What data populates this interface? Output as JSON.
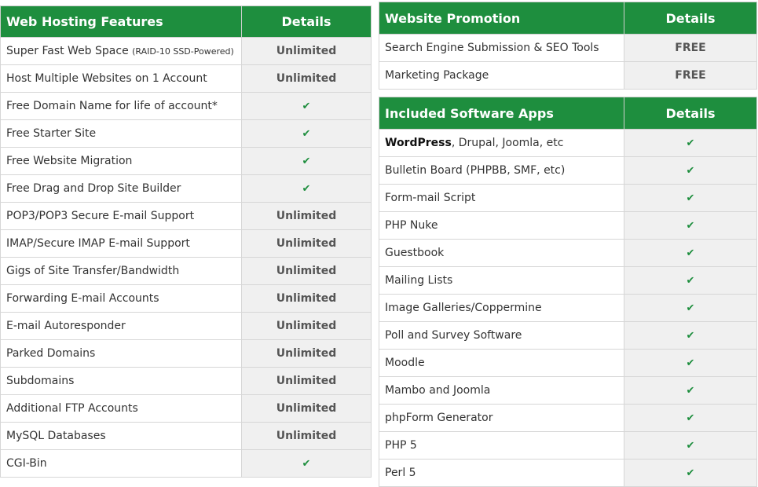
{
  "hosting": {
    "header": {
      "feature": "Web Hosting Features",
      "details": "Details"
    },
    "rows": [
      {
        "label": "Super Fast Web Space",
        "note": "(RAID-10 SSD-Powered)",
        "value": "Unlimited"
      },
      {
        "label": "Host Multiple Websites on 1 Account",
        "value": "Unlimited"
      },
      {
        "label": "Free Domain Name for life of account*",
        "value": "✔"
      },
      {
        "label": "Free Starter Site",
        "value": "✔"
      },
      {
        "label": "Free Website Migration",
        "value": "✔"
      },
      {
        "label": "Free Drag and Drop Site Builder",
        "value": "✔"
      },
      {
        "label": "POP3/POP3 Secure E-mail Support",
        "value": "Unlimited"
      },
      {
        "label": "IMAP/Secure IMAP E-mail Support",
        "value": "Unlimited"
      },
      {
        "label": "Gigs of Site Transfer/Bandwidth",
        "value": "Unlimited"
      },
      {
        "label": "Forwarding E-mail Accounts",
        "value": "Unlimited"
      },
      {
        "label": "E-mail Autoresponder",
        "value": "Unlimited"
      },
      {
        "label": "Parked Domains",
        "value": "Unlimited"
      },
      {
        "label": "Subdomains",
        "value": "Unlimited"
      },
      {
        "label": "Additional FTP Accounts",
        "value": "Unlimited"
      },
      {
        "label": "MySQL Databases",
        "value": "Unlimited"
      },
      {
        "label": "CGI-Bin",
        "value": "✔"
      }
    ]
  },
  "promotion": {
    "header": {
      "feature": "Website Promotion",
      "details": "Details"
    },
    "rows": [
      {
        "label": "Search Engine Submission & SEO Tools",
        "value": "FREE"
      },
      {
        "label": "Marketing Package",
        "value": "FREE"
      }
    ]
  },
  "software": {
    "header": {
      "feature": "Included Software Apps",
      "details": "Details"
    },
    "rows": [
      {
        "strong": "WordPress",
        "label": ", Drupal, Joomla, etc",
        "value": "✔"
      },
      {
        "label": "Bulletin Board (PHPBB, SMF, etc)",
        "value": "✔"
      },
      {
        "label": "Form-mail Script",
        "value": "✔"
      },
      {
        "label": "PHP Nuke",
        "value": "✔"
      },
      {
        "label": "Guestbook",
        "value": "✔"
      },
      {
        "label": "Mailing Lists",
        "value": "✔"
      },
      {
        "label": "Image Galleries/Coppermine",
        "value": "✔"
      },
      {
        "label": "Poll and Survey Software",
        "value": "✔"
      },
      {
        "label": "Moodle",
        "value": "✔"
      },
      {
        "label": "Mambo and Joomla",
        "value": "✔"
      },
      {
        "label": "phpForm Generator",
        "value": "✔"
      },
      {
        "label": "PHP 5",
        "value": "✔"
      },
      {
        "label": "Perl 5",
        "value": "✔"
      }
    ]
  },
  "colors": {
    "header_bg": "#1e8e3e",
    "check": "#1e8e3e",
    "details_bg": "#f0f0f0"
  }
}
